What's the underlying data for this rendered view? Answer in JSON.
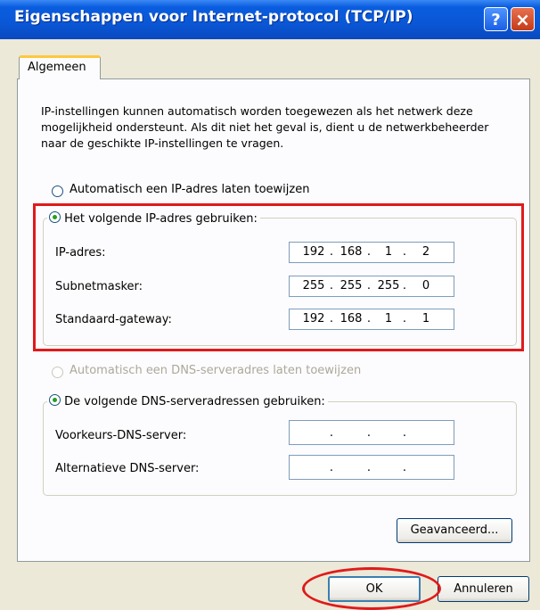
{
  "window": {
    "title": "Eigenschappen voor Internet-protocol (TCP/IP)",
    "help_label": "?",
    "close_label": "×"
  },
  "tabs": [
    {
      "label": "Algemeen"
    }
  ],
  "description": "IP-instellingen kunnen automatisch worden toegewezen als het netwerk deze mogelijkheid ondersteunt. Als dit niet het geval is, dient u de netwerkbeheerder naar de geschikte IP-instellingen te vragen.",
  "ip": {
    "auto_label": "Automatisch een IP-adres laten toewijzen",
    "manual_label": "Het volgende IP-adres gebruiken:",
    "auto_selected": false,
    "fields": [
      {
        "label": "IP-adres:",
        "octets": [
          "192",
          "168",
          "1",
          "2"
        ]
      },
      {
        "label": "Subnetmasker:",
        "octets": [
          "255",
          "255",
          "255",
          "0"
        ]
      },
      {
        "label": "Standaard-gateway:",
        "octets": [
          "192",
          "168",
          "1",
          "1"
        ]
      }
    ]
  },
  "dns": {
    "auto_label": "Automatisch een DNS-serveradres laten toewijzen",
    "manual_label": "De volgende DNS-serveradressen gebruiken:",
    "auto_disabled": true,
    "fields": [
      {
        "label": "Voorkeurs-DNS-server:",
        "octets": [
          "",
          "",
          "",
          ""
        ]
      },
      {
        "label": "Alternatieve DNS-server:",
        "octets": [
          "",
          "",
          "",
          ""
        ]
      }
    ]
  },
  "buttons": {
    "advanced": "Geavanceerd...",
    "ok": "OK",
    "cancel": "Annuleren"
  },
  "colors": {
    "titlebar": "#0a57d6",
    "highlight": "#e01a1a",
    "radio_dot": "#21a121",
    "dialog_bg": "#ece9d8"
  },
  "icons": {
    "help": "help-icon",
    "close": "close-icon"
  }
}
